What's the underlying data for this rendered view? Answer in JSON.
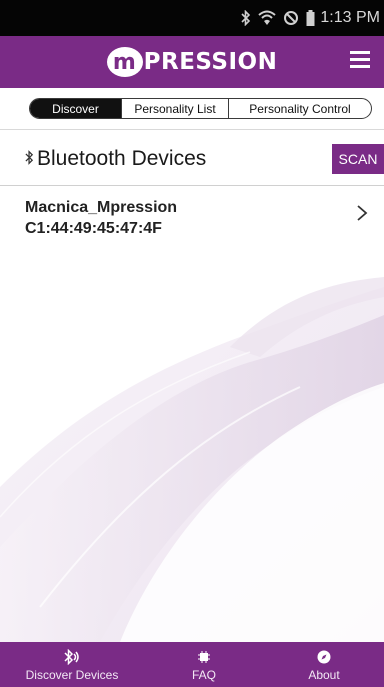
{
  "status_bar": {
    "time": "1:13 PM",
    "icons": [
      "bluetooth-icon",
      "wifi-icon",
      "do-not-disturb-icon",
      "battery-icon"
    ]
  },
  "header": {
    "logo_badge": "m",
    "logo_text": "PRESSION",
    "menu_icon": "hamburger-menu-icon"
  },
  "tabs": [
    {
      "label": "Discover",
      "active": true
    },
    {
      "label": "Personality List",
      "active": false
    },
    {
      "label": "Personality Control",
      "active": false
    }
  ],
  "bluetooth": {
    "title": "Bluetooth Devices",
    "scan_label": "SCAN"
  },
  "devices": [
    {
      "name": "Macnica_Mpression",
      "mac": "C1:44:49:45:47:4F"
    }
  ],
  "bottom_nav": [
    {
      "label": "Discover Devices",
      "icon": "bluetooth-search-icon"
    },
    {
      "label": "FAQ",
      "icon": "chip-icon"
    },
    {
      "label": "About",
      "icon": "compass-icon"
    }
  ],
  "colors": {
    "brand": "#7a2b86",
    "status_bar": "#050505"
  }
}
